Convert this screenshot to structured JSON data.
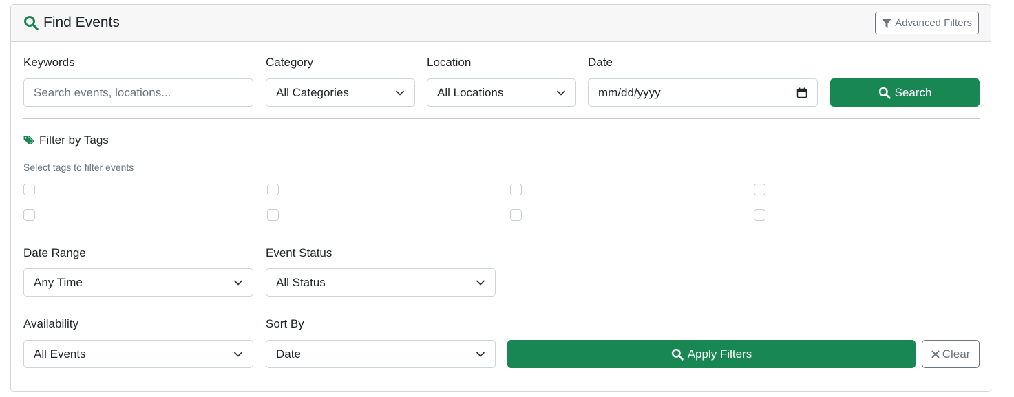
{
  "header": {
    "title": "Find Events",
    "title_icon": "search-icon",
    "advanced_filters_label": "Advanced Filters",
    "advanced_filters_icon": "filter-icon"
  },
  "search_row": {
    "keywords_label": "Keywords",
    "keywords_placeholder": "Search events, locations...",
    "category_label": "Category",
    "category_value": "All Categories",
    "location_label": "Location",
    "location_value": "All Locations",
    "date_label": "Date",
    "date_placeholder": "mm/dd/yyyy",
    "search_button": "Search"
  },
  "tags": {
    "title": "Filter by Tags",
    "title_icon": "tags-icon",
    "subtitle": "Select tags to filter events",
    "checkbox_count": 8
  },
  "filters": {
    "date_range_label": "Date Range",
    "date_range_value": "Any Time",
    "event_status_label": "Event Status",
    "event_status_value": "All Status",
    "availability_label": "Availability",
    "availability_value": "All Events",
    "sort_by_label": "Sort By",
    "sort_by_value": "Date",
    "apply_button": "Apply Filters",
    "clear_button": "Clear"
  },
  "colors": {
    "accent_green": "#198754",
    "border": "#ced4da",
    "muted": "#6c757d",
    "header_bg": "#f7f7f7"
  }
}
